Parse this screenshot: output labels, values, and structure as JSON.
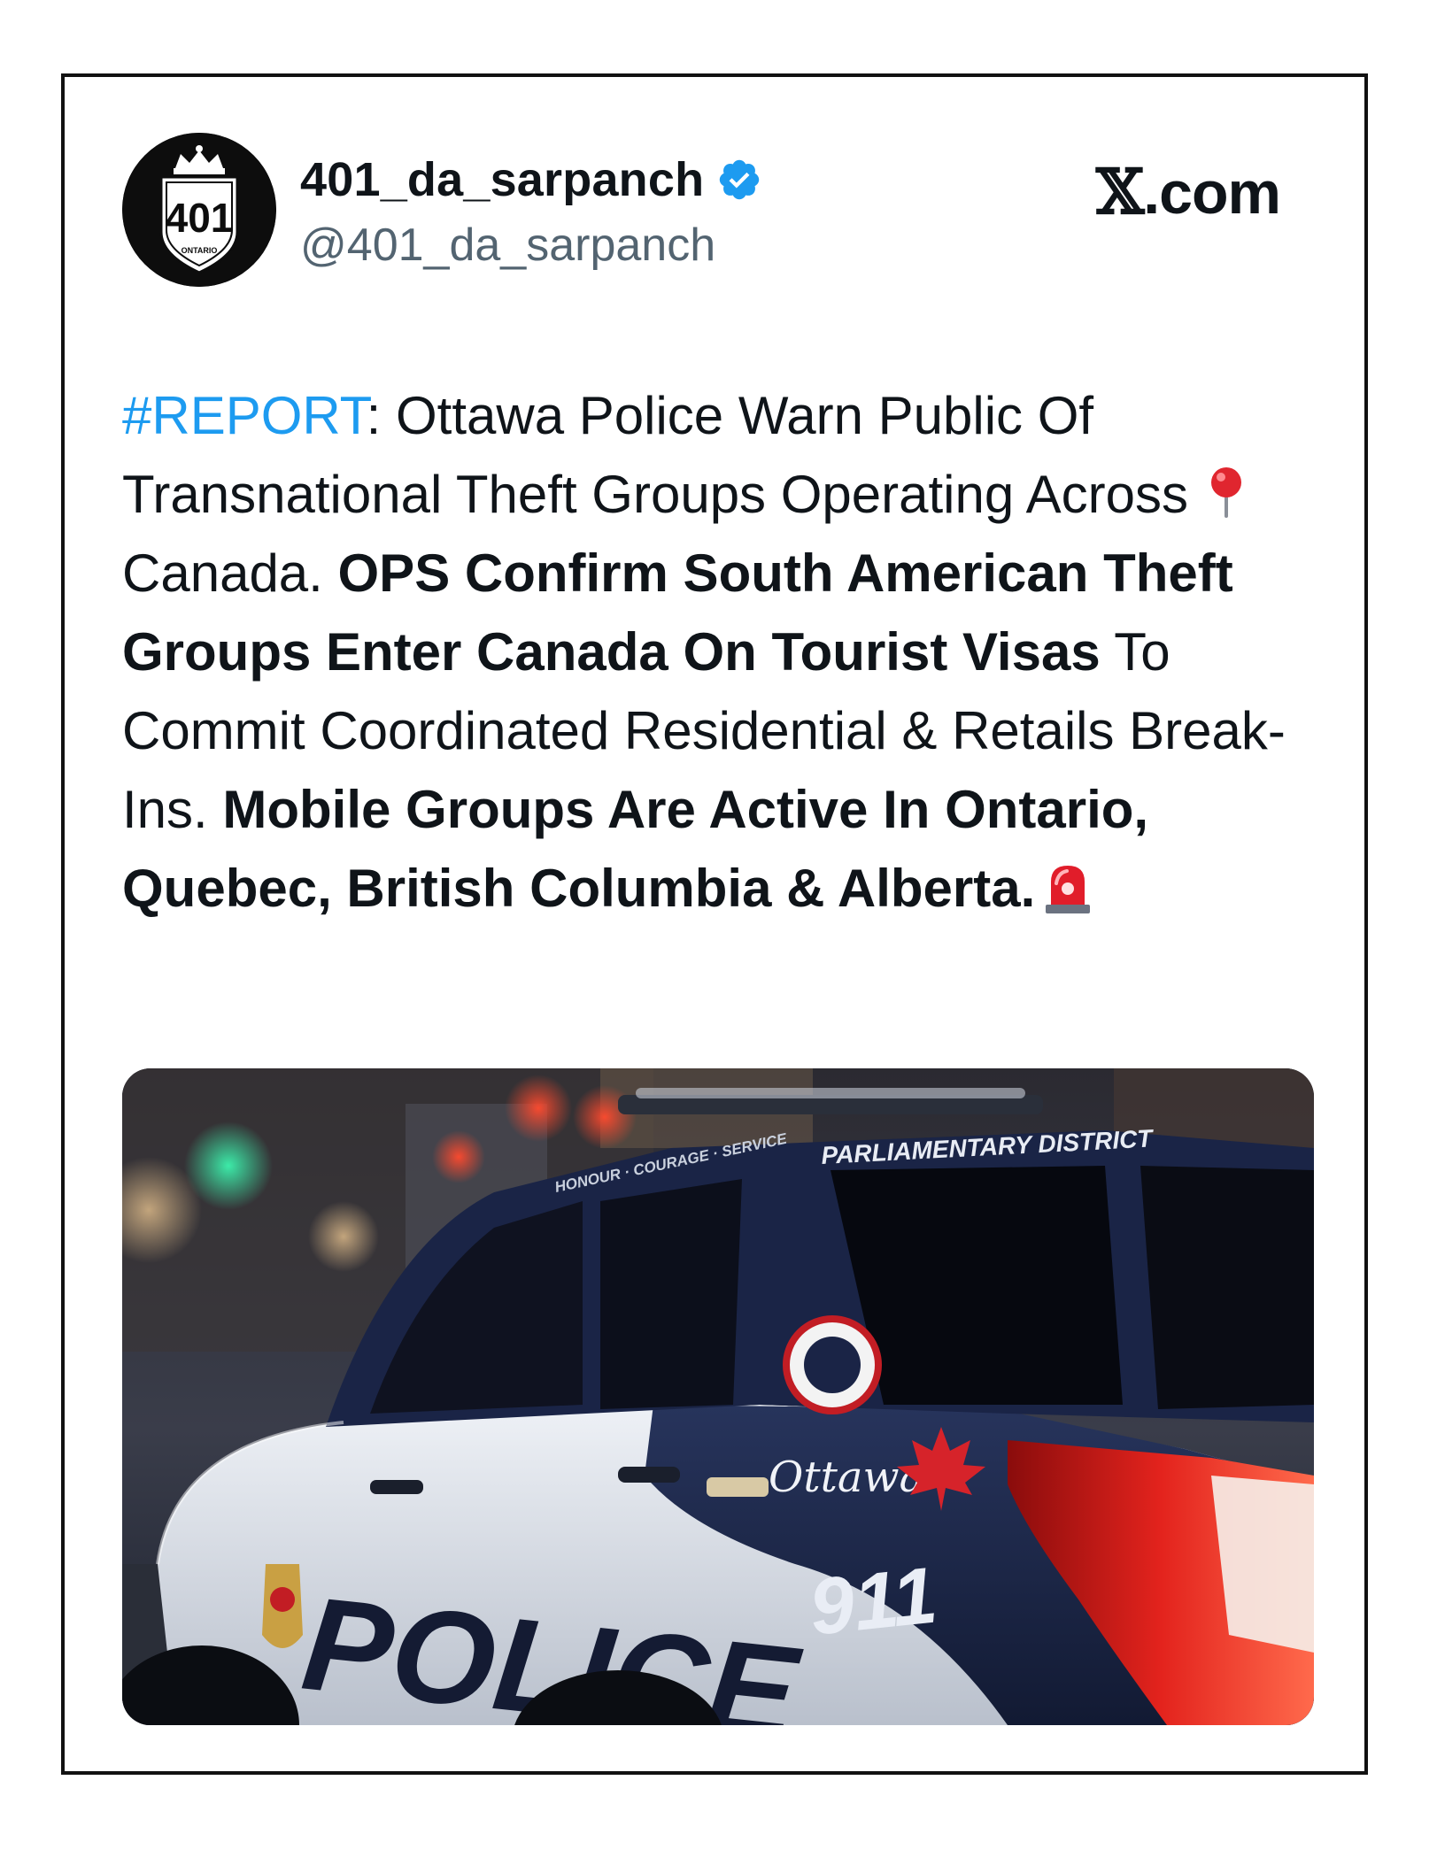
{
  "author": {
    "display_name": "401_da_sarpanch",
    "handle": "@401_da_sarpanch",
    "verified": true,
    "avatar": {
      "shield_number": "401",
      "shield_caption": "ONTARIO"
    }
  },
  "brand": {
    "site_x": "𝕏",
    "site_rest": ".com"
  },
  "tweet": {
    "hashtag": "#REPORT",
    "seg1": ": Ottawa Police Warn Public Of Transnational Theft Groups Operating Across ",
    "seg2": " Canada. ",
    "bold1": "OPS Confirm South American Theft Groups Enter Canada On Tourist Visas",
    "seg3": " To Commit Coordinated Residential & Retails Break-Ins. ",
    "bold2": "Mobile Groups Are Active In Ontario, Quebec, British Columbia & Alberta."
  },
  "media": {
    "vehicle_text_roof": "PARLIAMENTARY DISTRICT",
    "vehicle_text_motto": "HONOUR · COURAGE · SERVICE",
    "vehicle_text_side": "POLICE",
    "vehicle_text_number": "911",
    "vehicle_text_city": "Ottawa"
  },
  "colors": {
    "hashtag": "#1d9bf0",
    "verified_badge": "#1d9bf0",
    "text": "#0f1419",
    "handle": "#536471",
    "card_border": "#111111"
  }
}
